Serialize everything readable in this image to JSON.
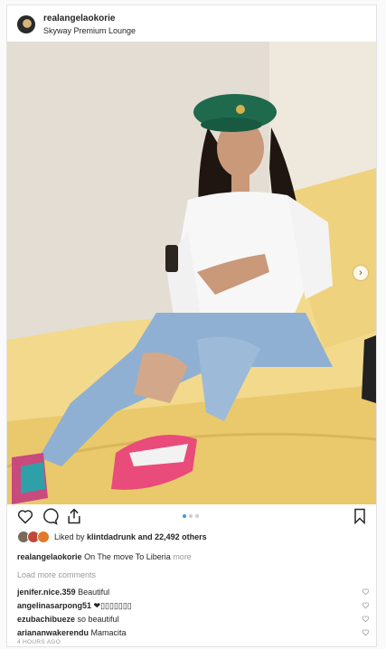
{
  "post": {
    "username": "realangelaokorie",
    "location": "Skyway Premium Lounge"
  },
  "carousel": {
    "next_icon": "chevron-right-icon",
    "current": 1,
    "total": 3
  },
  "actions": {
    "like_icon": "heart-icon",
    "comment_icon": "comment-icon",
    "share_icon": "share-icon",
    "save_icon": "bookmark-icon"
  },
  "likes": {
    "prefix": "Liked by",
    "user": "klintdadrunk",
    "suffix": "and 22,492 others"
  },
  "caption": {
    "username": "realangelaokorie",
    "text": "On The move To Liberia",
    "more": "more"
  },
  "load_more": "Load more comments",
  "comments": [
    {
      "user": "jenifer.nice.359",
      "text": "Beautiful"
    },
    {
      "user": "angelinasarpong51",
      "text": "❤▯▯▯▯▯▯▯"
    },
    {
      "user": "ezubachibueze",
      "text": "so beautiful"
    },
    {
      "user": "ariananwakerendu",
      "text": "Mamacita"
    }
  ],
  "timestamp": "4 HOURS AGO",
  "colors": {
    "accent": "#3897f0",
    "muted": "#999999",
    "text": "#262626"
  }
}
